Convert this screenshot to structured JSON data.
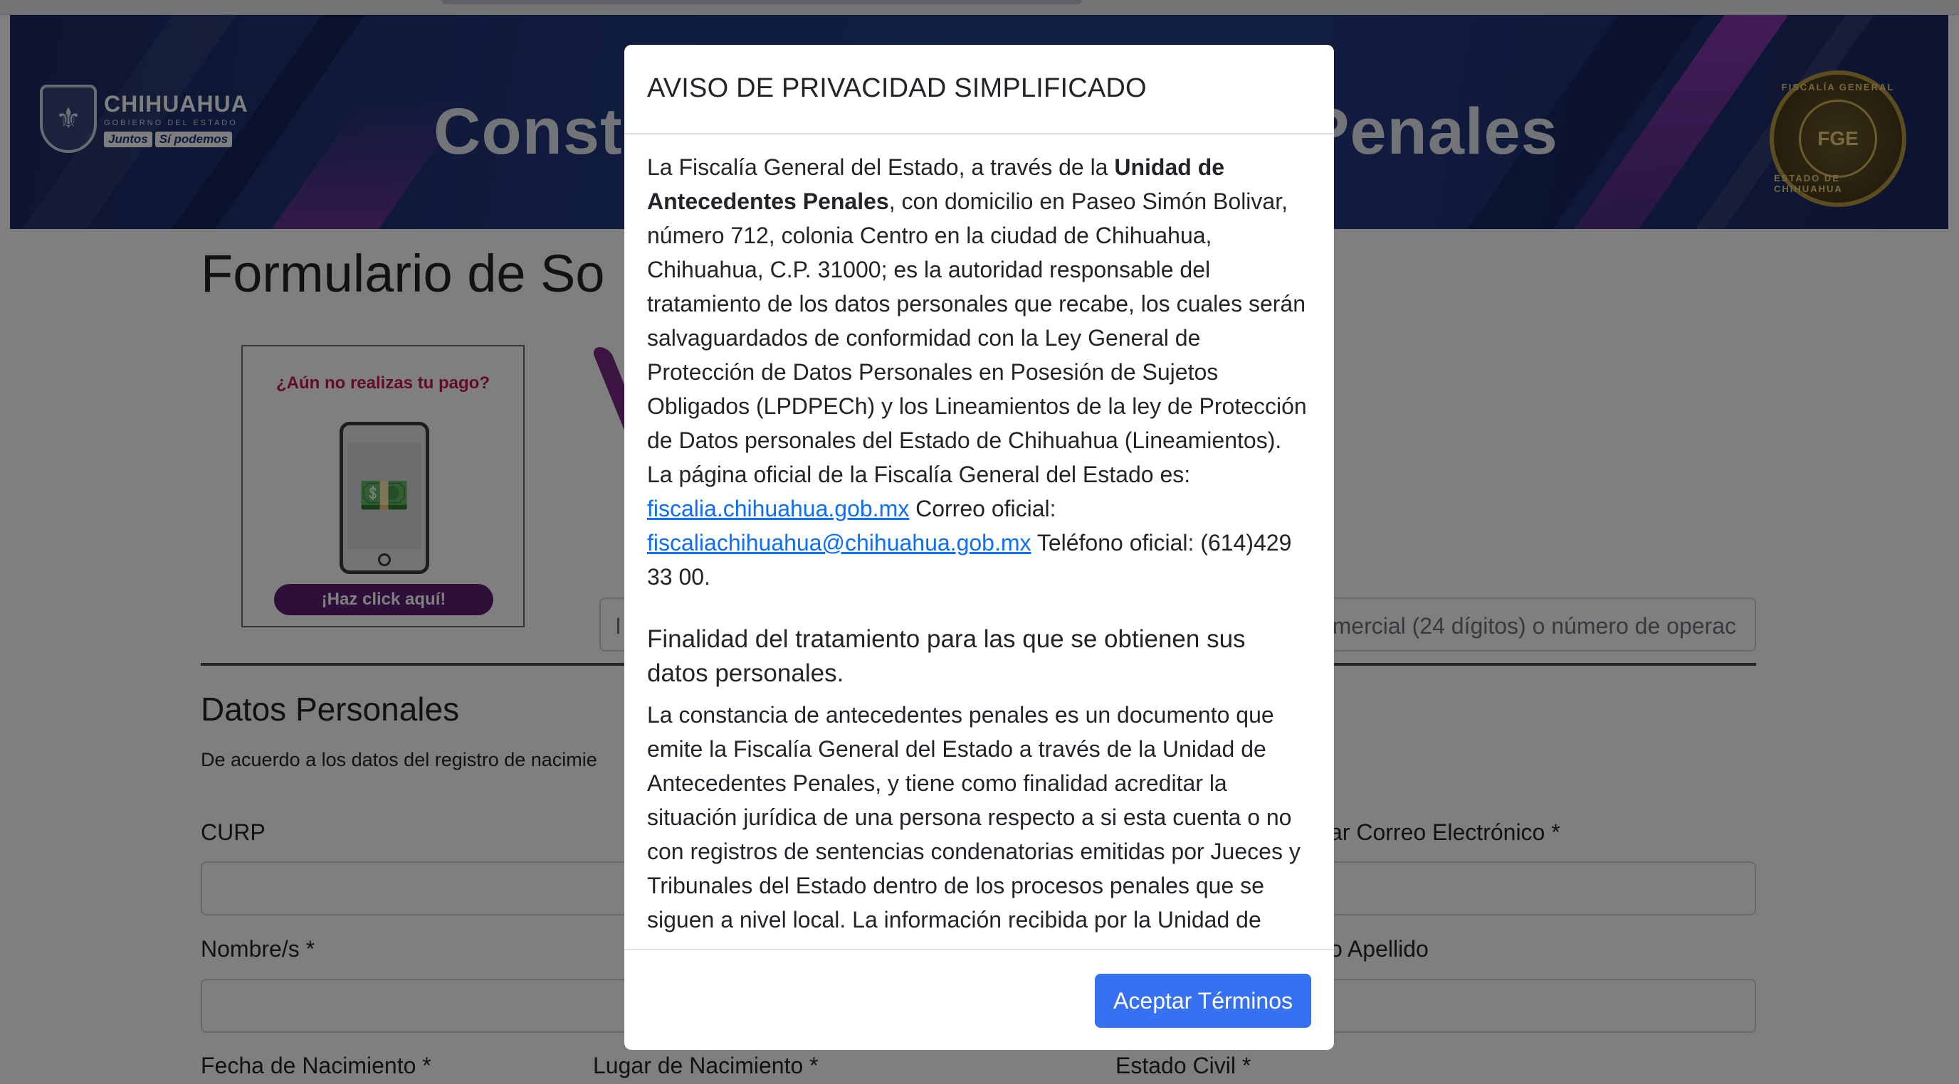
{
  "banner": {
    "brand_state": "CHIHUAHUA",
    "brand_gov": "GOBIERNO DEL ESTADO",
    "slogan_a": "Juntos",
    "slogan_b": "Sí podemos",
    "title_left": "Consta",
    "title_right": "Penales",
    "seal_text": "FGE",
    "seal_top": "FISCALÍA GENERAL",
    "seal_bottom": "ESTADO DE CHIHUAHUA"
  },
  "page": {
    "title": "Formulario de So",
    "pay_question": "¿Aún no realizas tu pago?",
    "pay_button": "¡Haz click aquí!",
    "ref_placeholder_left": "I",
    "ref_placeholder_right": "mercial (24 dígitos) o número de operac",
    "section_title": "Datos Personales",
    "section_desc": "De acuerdo a los datos del registro de nacimie",
    "labels": {
      "curp": "CURP",
      "confirm_email": "ar Correo Electrónico *",
      "nombres": "Nombre/s *",
      "second_surname": "o Apellido",
      "birth_date": "Fecha de Nacimiento *",
      "birth_place": "Lugar de Nacimiento *",
      "civil_status": "Estado Civil *"
    }
  },
  "modal": {
    "title": "AVISO DE PRIVACIDAD SIMPLIFICADO",
    "p1_a": "La Fiscalía General del Estado, a través de la ",
    "p1_bold": "Unidad de Antecedentes Penales",
    "p1_b": ", con domicilio en Paseo Simón Bolivar, número 712, colonia Centro en la ciudad de Chihuahua, Chihuahua, C.P. 31000; es la autoridad responsable del tratamiento de los datos personales que recabe, los cuales serán salvaguardados de conformidad con la Ley General de Protección de Datos Personales en Posesión de Sujetos Obligados (LPDPECh) y los Lineamientos de la ley de Protección de Datos personales del Estado de Chihuahua (Lineamientos). La página oficial de la Fiscalía General del Estado es: ",
    "link_site": "fiscalia.chihuahua.gob.mx",
    "p1_c": " Correo oficial: ",
    "link_email": "fiscaliachihuahua@chihuahua.gob.mx",
    "p1_d": " Teléfono oficial: (614)429 33 00.",
    "h2": "Finalidad del tratamiento para las que se obtienen sus datos personales.",
    "p2": "La constancia de antecedentes penales es un documento que emite la Fiscalía General del Estado a través de la Unidad de Antecedentes Penales, y tiene como finalidad acreditar la situación jurídica de una persona respecto a si esta cuenta o no con registros de sentencias condenatorias emitidas por Jueces y Tribunales del Estado dentro de los procesos penales que se siguen a nivel local. La información recibida por la Unidad de",
    "accept_button": "Aceptar Términos"
  },
  "colors": {
    "accent": "#3671f2",
    "link": "#0d6efd",
    "banner": "#1f3577",
    "pay_question": "#c2185b",
    "pay_button": "#5b1f73"
  }
}
